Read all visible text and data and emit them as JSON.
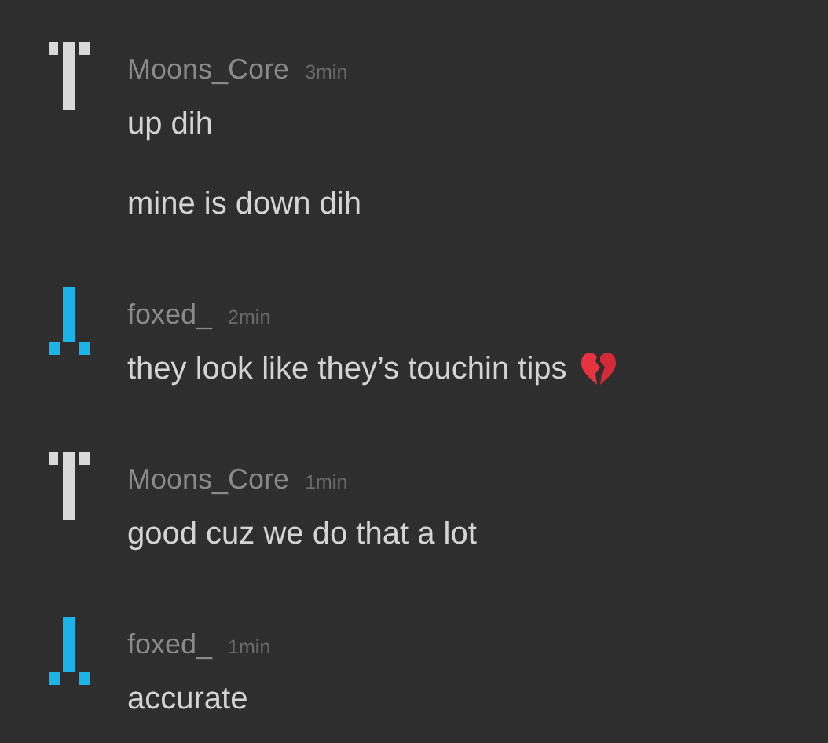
{
  "messages": [
    {
      "author": "Moons_Core",
      "time": "3min",
      "avatar": {
        "kind": "tee",
        "color": "#d9d9d9"
      },
      "lines": [
        {
          "text": "up dih"
        },
        {
          "text": "mine is down dih"
        }
      ]
    },
    {
      "author": "foxed_",
      "time": "2min",
      "avatar": {
        "kind": "inverted",
        "color": "#1ab3ea"
      },
      "lines": [
        {
          "text": "they look like they’s touchin tips",
          "broken_heart": true
        }
      ]
    },
    {
      "author": "Moons_Core",
      "time": "1min",
      "avatar": {
        "kind": "tee",
        "color": "#d9d9d9"
      },
      "lines": [
        {
          "text": "good cuz we do that a lot"
        }
      ]
    },
    {
      "author": "foxed_",
      "time": "1min",
      "avatar": {
        "kind": "inverted",
        "color": "#1ab3ea"
      },
      "lines": [
        {
          "text": "accurate"
        }
      ]
    }
  ]
}
